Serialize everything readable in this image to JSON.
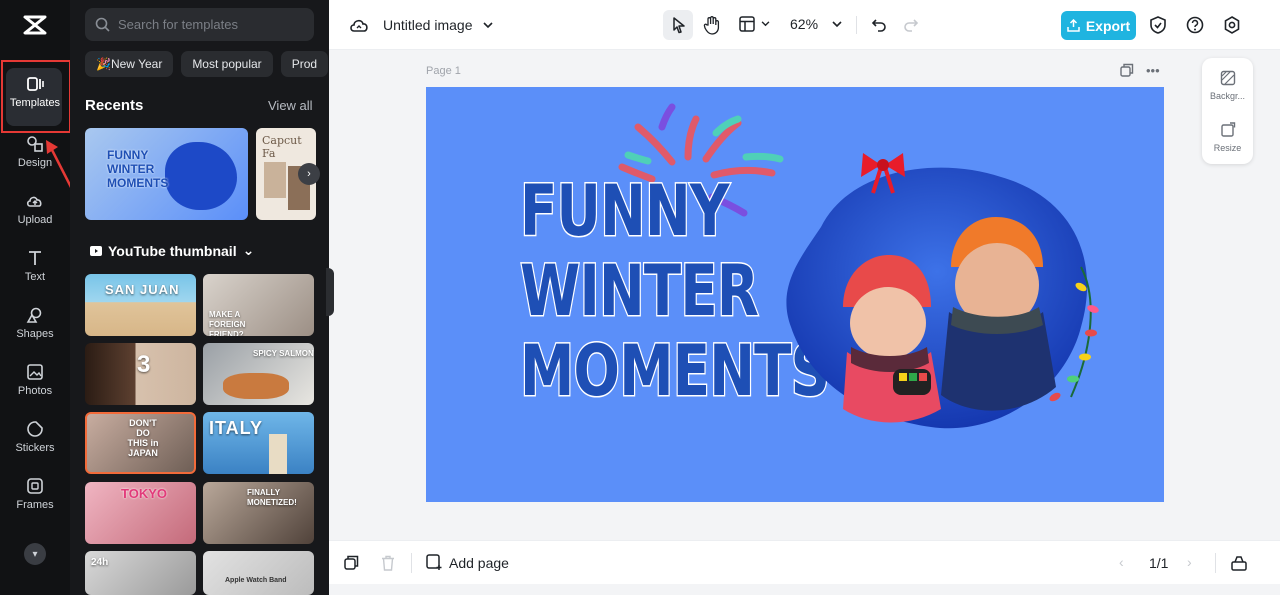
{
  "app": {
    "logo": "capcut-logo"
  },
  "rail": {
    "items": [
      {
        "label": "Templates",
        "icon": "templates-icon"
      },
      {
        "label": "Design",
        "icon": "design-icon"
      },
      {
        "label": "Upload",
        "icon": "upload-icon"
      },
      {
        "label": "Text",
        "icon": "text-icon"
      },
      {
        "label": "Shapes",
        "icon": "shapes-icon"
      },
      {
        "label": "Photos",
        "icon": "photos-icon"
      },
      {
        "label": "Stickers",
        "icon": "stickers-icon"
      },
      {
        "label": "Frames",
        "icon": "frames-icon"
      }
    ]
  },
  "panel": {
    "search_placeholder": "Search for templates",
    "chips": [
      "🎉New Year",
      "Most popular",
      "Prod"
    ],
    "recents_title": "Recents",
    "view_all": "View all",
    "recent_cards": [
      {
        "label": "FUNNY WINTER MOMENTS"
      },
      {
        "label": "Capcut Fa"
      }
    ],
    "youtube_title": "YouTube thumbnail",
    "youtube_cards": [
      {
        "label": "SAN JUAN"
      },
      {
        "label": "MAKE A FOREIGN FRIEND?"
      },
      {
        "label": "3"
      },
      {
        "label": "SPICY SALMON"
      },
      {
        "label": "DON'T DO THIS in JAPAN"
      },
      {
        "label": "ITALY"
      },
      {
        "label": "TOKYO"
      },
      {
        "label": "FINALLY MONETIZED!"
      },
      {
        "label": "24h"
      },
      {
        "label": "Apple Watch Band"
      }
    ]
  },
  "topbar": {
    "title": "Untitled image",
    "zoom": "62%",
    "export_label": "Export"
  },
  "canvas": {
    "page_label": "Page 1",
    "headline": [
      "FUNNY",
      "WINTER",
      "MOMENTS"
    ]
  },
  "side_tools": {
    "background": "Backgr...",
    "resize": "Resize"
  },
  "bottom": {
    "add_page": "Add page",
    "page_counter": "1/1"
  },
  "colors": {
    "accent": "#1fb4e0",
    "design_bg": "#5b8ff9",
    "headline": "#1e4fb5",
    "highlight": "#e53935"
  }
}
